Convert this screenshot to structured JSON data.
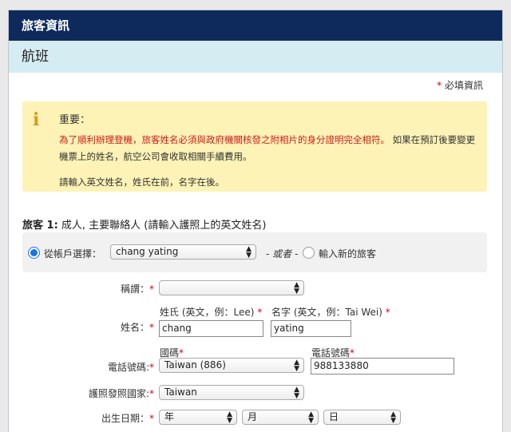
{
  "header": {
    "title": "旅客資訊"
  },
  "section": {
    "title": "航班"
  },
  "required_note": {
    "star": "*",
    "text": "必填資訊"
  },
  "notice": {
    "title": "重要：",
    "red_text": "為了順利辦理登機，旅客姓名必須與政府機關核發之附相片的身分證明完全相符。",
    "black_text": " 如果在預訂後要變更機票上的姓名，航空公司會收取相關手續費用。",
    "instruction": "請輸入英文姓名，姓氏在前，名字在後。"
  },
  "traveler": {
    "title_bold": "旅客 1:",
    "title_rest": " 成人, 主要聯絡人 (請輸入護照上的英文姓名)"
  },
  "choose": {
    "from_account_label": "從帳戶選擇：",
    "account_value": "chang yating",
    "or_text": "- 或者 -",
    "new_traveler_label": "輸入新的旅客"
  },
  "form": {
    "title_label": "稱謂：",
    "title_value": "",
    "name_label": "姓名：",
    "last_name_label": "姓氏 (英文，例：Lee)",
    "first_name_label": "名字 (英文，例：Tai Wei)",
    "last_name_value": "chang",
    "first_name_value": "yating",
    "phone_label": "電話號碼:",
    "country_code_label": "國碼",
    "phone_number_label": "電話號碼",
    "country_code_value": "Taiwan (886)",
    "phone_value": "988133880",
    "passport_country_label": "護照發照國家:",
    "passport_country_value": "Taiwan",
    "dob_label": "出生日期：",
    "dob_year": "年",
    "dob_month": "月",
    "dob_day": "日",
    "star": "*"
  },
  "icons": {
    "info": "info-icon",
    "select_arrows": "updown-arrow-icon"
  },
  "colors": {
    "header_bg": "#0e2a5c",
    "subhead_bg": "#d6ecf3",
    "notice_bg": "#fdf3b6",
    "required": "#d0021b",
    "radio_selected": "#1a73e8"
  }
}
